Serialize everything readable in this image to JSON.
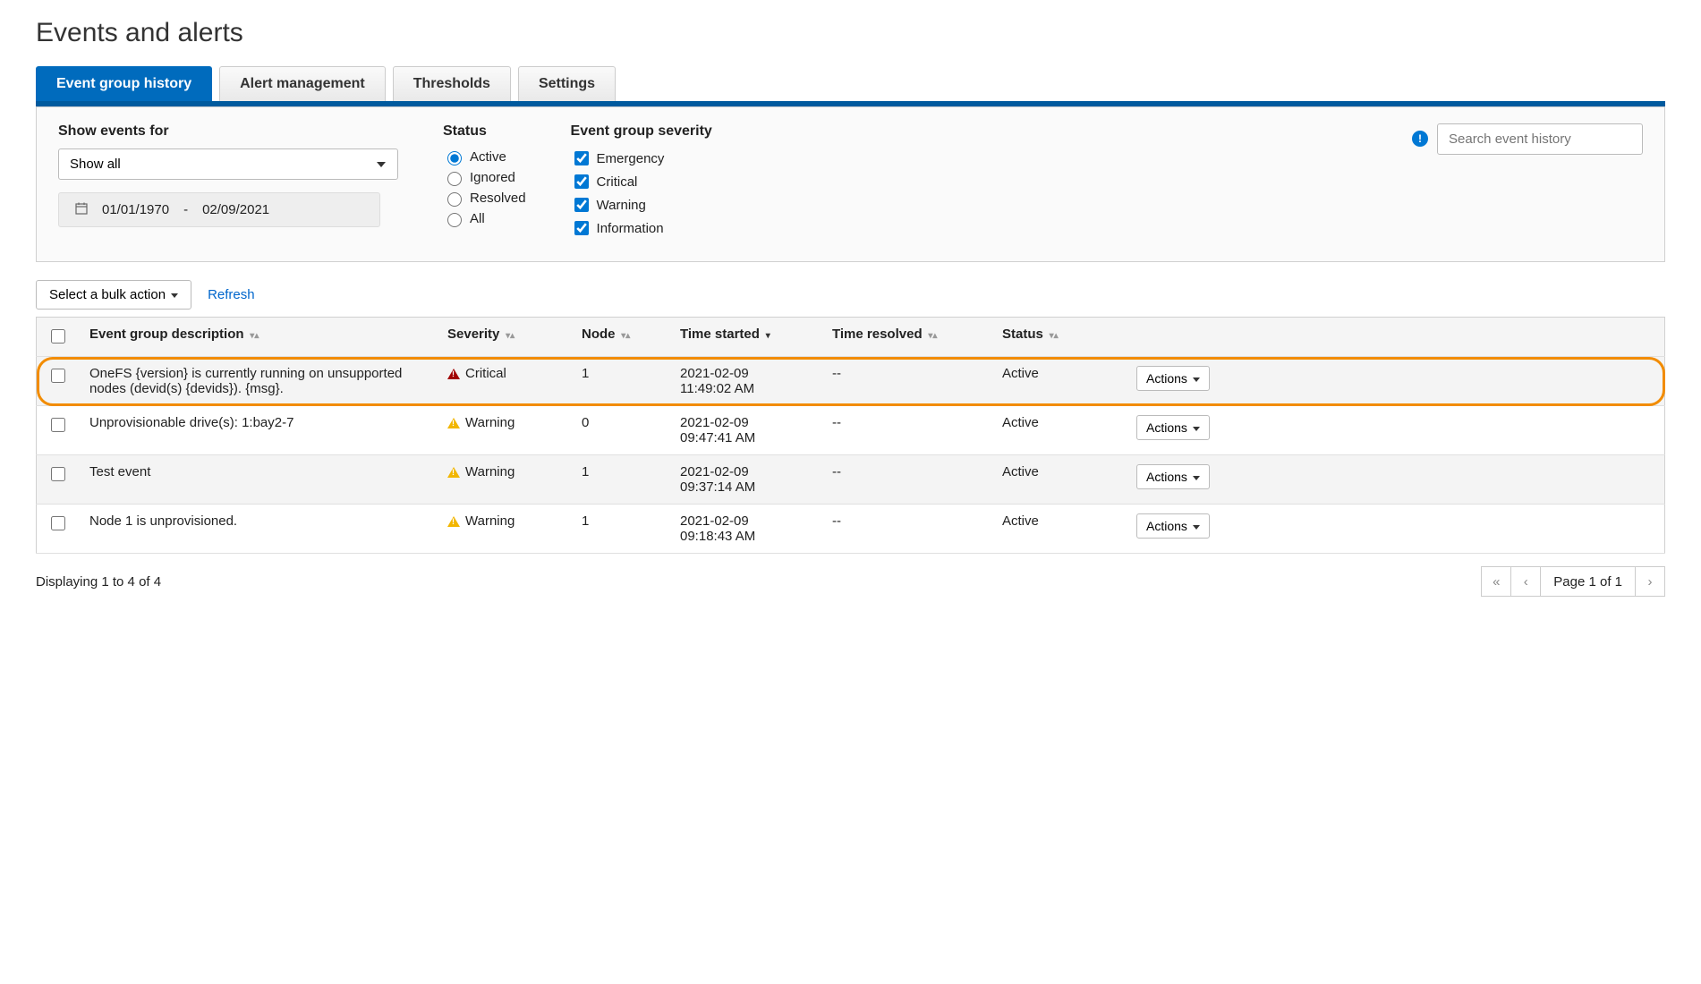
{
  "page_title": "Events and alerts",
  "tabs": [
    "Event group history",
    "Alert management",
    "Thresholds",
    "Settings"
  ],
  "active_tab": 0,
  "filters": {
    "show_events_label": "Show events for",
    "show_events_value": "Show all",
    "date_start": "01/01/1970",
    "date_sep": "-",
    "date_end": "02/09/2021",
    "status_label": "Status",
    "status_options": [
      "Active",
      "Ignored",
      "Resolved",
      "All"
    ],
    "status_selected": 0,
    "severity_label": "Event group severity",
    "severity_options": [
      "Emergency",
      "Critical",
      "Warning",
      "Information"
    ],
    "search_placeholder": "Search event history"
  },
  "toolbar": {
    "bulk_label": "Select a bulk action",
    "refresh_label": "Refresh"
  },
  "columns": {
    "desc": "Event group description",
    "severity": "Severity",
    "node": "Node",
    "started": "Time started",
    "resolved": "Time resolved",
    "status": "Status"
  },
  "rows": [
    {
      "description": "OneFS {version} is currently running on unsupported nodes (devid(s) {devids}). {msg}.",
      "severity": "Critical",
      "severity_kind": "critical",
      "node": "1",
      "started": "2021-02-09 11:49:02 AM",
      "resolved": "--",
      "status": "Active",
      "highlighted": true
    },
    {
      "description": "Unprovisionable drive(s): 1:bay2-7",
      "severity": "Warning",
      "severity_kind": "warning",
      "node": "0",
      "started": "2021-02-09 09:47:41 AM",
      "resolved": "--",
      "status": "Active",
      "highlighted": false
    },
    {
      "description": "Test event",
      "severity": "Warning",
      "severity_kind": "warning",
      "node": "1",
      "started": "2021-02-09 09:37:14 AM",
      "resolved": "--",
      "status": "Active",
      "highlighted": false
    },
    {
      "description": "Node 1 is unprovisioned.",
      "severity": "Warning",
      "severity_kind": "warning",
      "node": "1",
      "started": "2021-02-09 09:18:43 AM",
      "resolved": "--",
      "status": "Active",
      "highlighted": false
    }
  ],
  "actions_label": "Actions",
  "footer_text": "Displaying 1 to 4 of 4",
  "pager_label": "Page 1 of 1"
}
